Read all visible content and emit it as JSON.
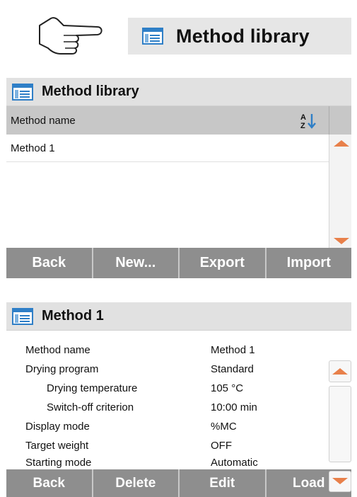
{
  "hint": {
    "icon": "pointing-hand-icon",
    "title": "Method library"
  },
  "library": {
    "icon": "method-library-icon",
    "title": "Method library",
    "column_header": "Method name",
    "sort_icon": "sort-az-icon",
    "sort_glyph_top": "A",
    "sort_glyph_bottom": "Z",
    "rows": [
      "Method 1"
    ],
    "buttons": {
      "back": "Back",
      "new": "New...",
      "export": "Export",
      "import": "Import"
    }
  },
  "method": {
    "icon": "method-library-icon",
    "title": "Method 1",
    "rows": [
      {
        "label": "Method name",
        "value": "Method 1",
        "indent": false
      },
      {
        "label": "Drying program",
        "value": "Standard",
        "indent": false
      },
      {
        "label": "Drying temperature",
        "value": "105 °C",
        "indent": true
      },
      {
        "label": "Switch-off criterion",
        "value": "10:00 min",
        "indent": true
      },
      {
        "label": "Display mode",
        "value": "%MC",
        "indent": false
      },
      {
        "label": "Target weight",
        "value": "OFF",
        "indent": false
      },
      {
        "label": "Starting mode",
        "value": "Automatic",
        "indent": false
      }
    ],
    "buttons": {
      "back": "Back",
      "delete": "Delete",
      "edit": "Edit",
      "load": "Load"
    }
  },
  "colors": {
    "accent_arrow": "#e8804a",
    "button_bar": "#8e8e8e",
    "title_bar": "#e1e1e1",
    "column_header": "#c7c7c7",
    "icon_blue": "#2f7fc7"
  }
}
